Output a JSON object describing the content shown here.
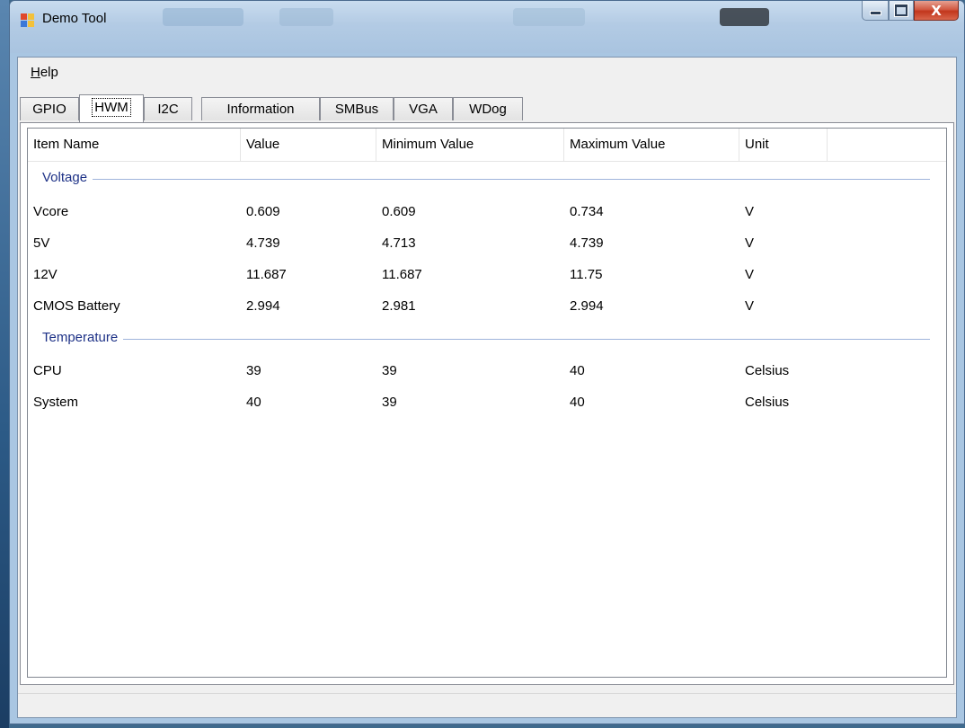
{
  "window": {
    "title": "Demo Tool",
    "close_glyph": "X"
  },
  "menu": {
    "help": {
      "mnemonic": "H",
      "rest": "elp"
    }
  },
  "tabs": [
    "GPIO",
    "HWM",
    "I2C",
    "Information",
    "SMBus",
    "VGA",
    "WDog"
  ],
  "active_tab": "HWM",
  "list": {
    "columns": [
      "Item Name",
      "Value",
      "Minimum Value",
      "Maximum Value",
      "Unit"
    ],
    "groups": [
      {
        "name": "Voltage",
        "rows": [
          {
            "item": "Vcore",
            "value": "0.609",
            "min": "0.609",
            "max": "0.734",
            "unit": "V"
          },
          {
            "item": "5V",
            "value": "4.739",
            "min": "4.713",
            "max": "4.739",
            "unit": "V"
          },
          {
            "item": "12V",
            "value": "11.687",
            "min": "11.687",
            "max": "11.75",
            "unit": "V"
          },
          {
            "item": "CMOS Battery",
            "value": "2.994",
            "min": "2.981",
            "max": "2.994",
            "unit": "V"
          }
        ]
      },
      {
        "name": "Temperature",
        "rows": [
          {
            "item": "CPU",
            "value": "39",
            "min": "39",
            "max": "40",
            "unit": "Celsius"
          },
          {
            "item": "System",
            "value": "40",
            "min": "39",
            "max": "40",
            "unit": "Celsius"
          }
        ]
      }
    ]
  },
  "colors": {
    "group_header": "#1e3287",
    "group_line": "#9fb4db",
    "close_button": "#c2361c"
  }
}
